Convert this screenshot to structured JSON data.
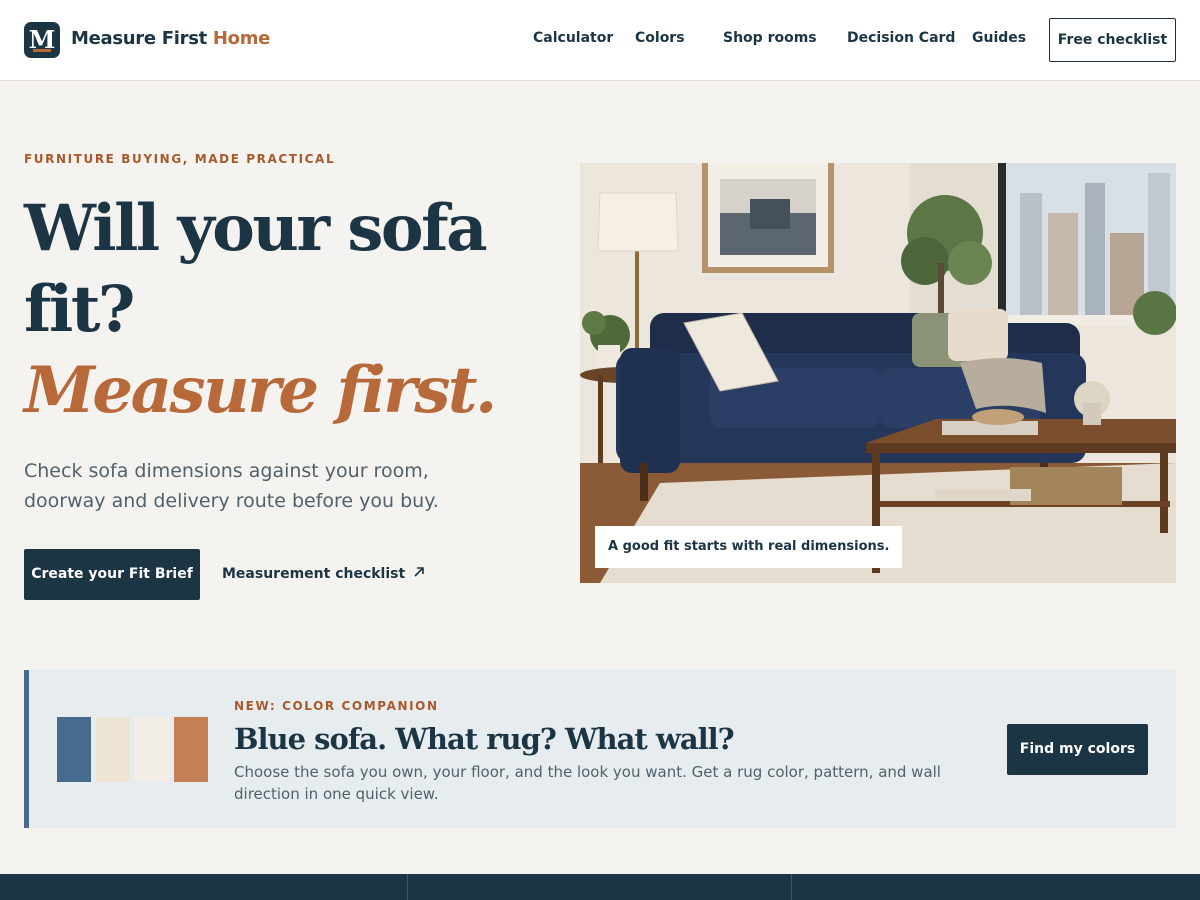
{
  "header": {
    "logo_letter": "M",
    "brand_name": "Measure First",
    "brand_accent": "Home",
    "nav": {
      "calculator": "Calculator",
      "colors": "Colors",
      "shop_rooms": "Shop rooms",
      "decision_card": "Decision Card",
      "guides": "Guides"
    },
    "cta": "Free checklist"
  },
  "hero": {
    "eyebrow": "FURNITURE BUYING, MADE PRACTICAL",
    "title_line1": "Will your sofa",
    "title_line2": "fit?",
    "title_line3": "Measure first.",
    "description": "Check sofa dimensions against your room, doorway and delivery route before you buy.",
    "primary_cta": "Create your Fit Brief",
    "secondary_cta": "Measurement checklist",
    "secondary_cta_icon": "arrow-up-right-icon",
    "image_caption": "A good fit starts with real dimensions."
  },
  "banner": {
    "eyebrow": "NEW: COLOR COMPANION",
    "title": "Blue sofa. What rug? What wall?",
    "description": "Choose the sofa you own, your floor, and the look you want. Get a rug color, pattern, and wall direction in one quick view.",
    "cta": "Find my colors",
    "swatches": [
      "#466b8c",
      "#ede4d6",
      "#f3efe8",
      "#c47f55"
    ]
  },
  "colors": {
    "brand_navy": "#1c3545",
    "accent_terracotta": "#b8693a",
    "page_background": "#f5f3ef"
  }
}
